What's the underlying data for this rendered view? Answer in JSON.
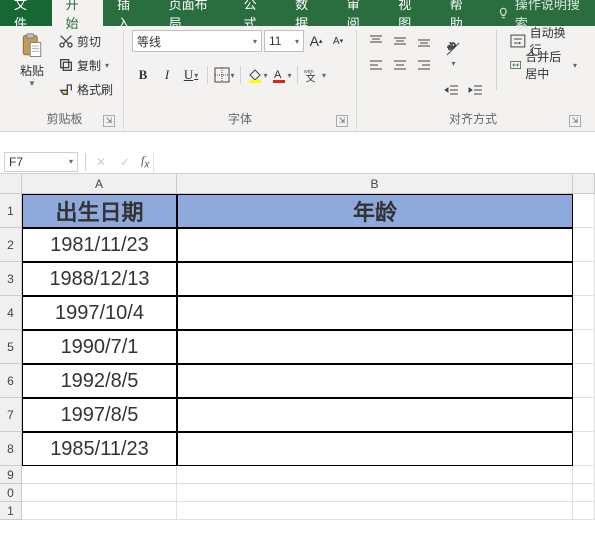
{
  "tabs": {
    "file": "文件",
    "home": "开始",
    "insert": "插入",
    "layout": "页面布局",
    "formulas": "公式",
    "data": "数据",
    "review": "审阅",
    "view": "视图",
    "help": "帮助",
    "tell_me": "操作说明搜索"
  },
  "ribbon": {
    "clipboard": {
      "paste": "粘贴",
      "cut": "剪切",
      "copy": "复制",
      "format_painter": "格式刷",
      "group_label": "剪贴板"
    },
    "font": {
      "name": "等线",
      "size": "11",
      "group_label": "字体",
      "ruby": "wén"
    },
    "alignment": {
      "wrap": "自动换行",
      "merge": "合并后居中",
      "group_label": "对齐方式"
    }
  },
  "fx": {
    "name_box": "F7",
    "formula": ""
  },
  "columns": {
    "A": "A",
    "B": "B"
  },
  "rows": [
    "1",
    "2",
    "3",
    "4",
    "5",
    "6",
    "7",
    "8",
    "9",
    "0",
    "1"
  ],
  "table": {
    "header": {
      "a": "出生日期",
      "b": "年龄"
    },
    "data": [
      {
        "a": "1981/11/23",
        "b": ""
      },
      {
        "a": "1988/12/13",
        "b": ""
      },
      {
        "a": "1997/10/4",
        "b": ""
      },
      {
        "a": "1990/7/1",
        "b": ""
      },
      {
        "a": "1992/8/5",
        "b": ""
      },
      {
        "a": "1997/8/5",
        "b": ""
      },
      {
        "a": "1985/11/23",
        "b": ""
      }
    ]
  }
}
